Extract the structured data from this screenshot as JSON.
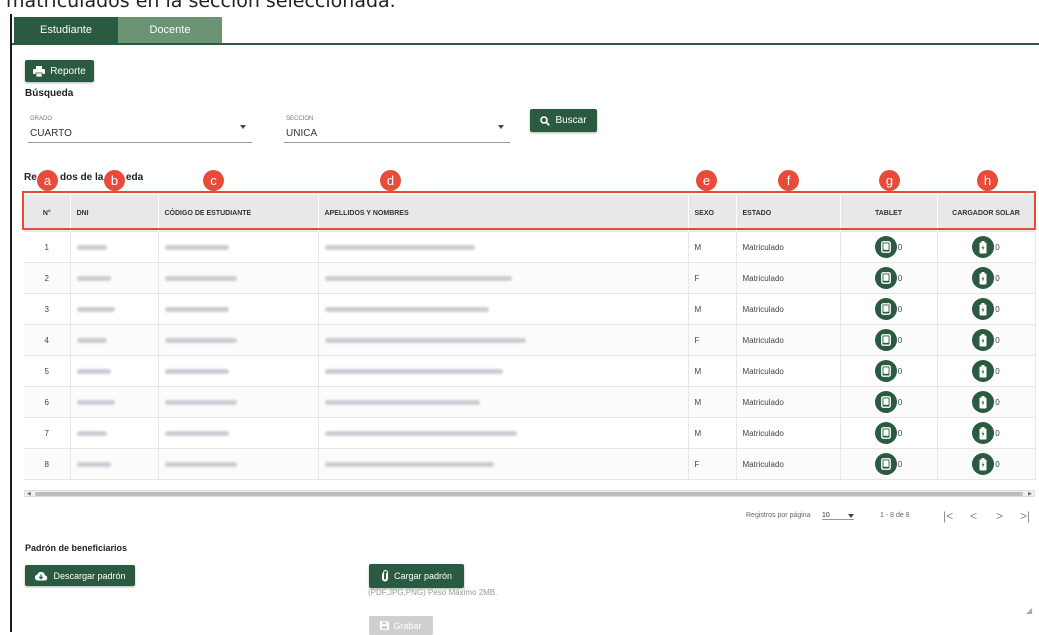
{
  "caption": "matriculados en la sección seleccionada.",
  "tabs": [
    {
      "label": "Estudiante"
    },
    {
      "label": "Docente"
    }
  ],
  "report_button": {
    "label": "Reporte"
  },
  "search": {
    "title": "Búsqueda",
    "grado": {
      "label": "GRADO",
      "value": "CUARTO"
    },
    "seccion": {
      "label": "SECCION",
      "value": "UNICA"
    },
    "button": "Buscar"
  },
  "results": {
    "title_part1": "Re",
    "title_part2": "dos de la",
    "title_part3": "eda"
  },
  "badges": [
    "a",
    "b",
    "c",
    "d",
    "e",
    "f",
    "g",
    "h"
  ],
  "table": {
    "headers": {
      "n": "N°",
      "dni": "DNI",
      "codigo": "CÓDIGO DE ESTUDIANTE",
      "nombres": "APELLIDOS Y NOMBRES",
      "sexo": "SEXO",
      "estado": "ESTADO",
      "tablet": "TABLET",
      "cargador": "CARGADOR SOLAR"
    },
    "rows": [
      {
        "n": "1",
        "sexo": "M",
        "estado": "Matriculado",
        "tablet": "0",
        "cargador": "0"
      },
      {
        "n": "2",
        "sexo": "F",
        "estado": "Matriculado",
        "tablet": "0",
        "cargador": "0"
      },
      {
        "n": "3",
        "sexo": "M",
        "estado": "Matriculado",
        "tablet": "0",
        "cargador": "0"
      },
      {
        "n": "4",
        "sexo": "F",
        "estado": "Matriculado",
        "tablet": "0",
        "cargador": "0"
      },
      {
        "n": "5",
        "sexo": "M",
        "estado": "Matriculado",
        "tablet": "0",
        "cargador": "0"
      },
      {
        "n": "6",
        "sexo": "M",
        "estado": "Matriculado",
        "tablet": "0",
        "cargador": "0"
      },
      {
        "n": "7",
        "sexo": "M",
        "estado": "Matriculado",
        "tablet": "0",
        "cargador": "0"
      },
      {
        "n": "8",
        "sexo": "F",
        "estado": "Matriculado",
        "tablet": "0",
        "cargador": "0"
      }
    ]
  },
  "pagination": {
    "per_page_label": "Registros por página",
    "per_page_value": "10",
    "range": "1 - 8 de 8"
  },
  "padron": {
    "title": "Padrón de beneficiarios",
    "download_button": "Descargar padrón",
    "upload_button": "Cargar padrón",
    "hint": "(PDF,JPG,PNG) Peso Máximo 2MB.",
    "save_button": "Grabar"
  },
  "colors": {
    "primary": "#2a5a3f",
    "tab_inactive": "#6a9474",
    "annotation": "#e84b3a"
  }
}
